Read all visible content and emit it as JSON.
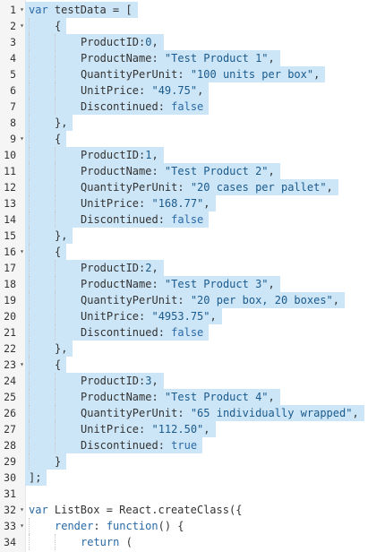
{
  "editor": {
    "lines": [
      {
        "n": "1",
        "fold": true,
        "indent": 0,
        "hl": true,
        "tokens": [
          [
            "kw",
            "var"
          ],
          [
            "pun",
            " testData = ["
          ]
        ]
      },
      {
        "n": "2",
        "fold": true,
        "indent": 1,
        "hl": true,
        "tokens": [
          [
            "pun",
            "{"
          ]
        ]
      },
      {
        "n": "3",
        "fold": false,
        "indent": 2,
        "hl": true,
        "tokens": [
          [
            "prop",
            "ProductID:"
          ],
          [
            "num-t",
            "0"
          ],
          [
            "pun",
            ","
          ]
        ]
      },
      {
        "n": "4",
        "fold": false,
        "indent": 2,
        "hl": true,
        "tokens": [
          [
            "prop",
            "ProductName: "
          ],
          [
            "str",
            "\"Test Product 1\""
          ],
          [
            "pun",
            ","
          ]
        ]
      },
      {
        "n": "5",
        "fold": false,
        "indent": 2,
        "hl": true,
        "tokens": [
          [
            "prop",
            "QuantityPerUnit: "
          ],
          [
            "str",
            "\"100 units per box\""
          ],
          [
            "pun",
            ","
          ]
        ]
      },
      {
        "n": "6",
        "fold": false,
        "indent": 2,
        "hl": true,
        "tokens": [
          [
            "prop",
            "UnitPrice: "
          ],
          [
            "str",
            "\"49.75\""
          ],
          [
            "pun",
            ","
          ]
        ]
      },
      {
        "n": "7",
        "fold": false,
        "indent": 2,
        "hl": true,
        "tokens": [
          [
            "prop",
            "Discontinued: "
          ],
          [
            "kw",
            "false"
          ]
        ]
      },
      {
        "n": "8",
        "fold": false,
        "indent": 1,
        "hl": true,
        "tokens": [
          [
            "pun",
            "},"
          ]
        ]
      },
      {
        "n": "9",
        "fold": true,
        "indent": 1,
        "hl": true,
        "tokens": [
          [
            "pun",
            "{"
          ]
        ]
      },
      {
        "n": "10",
        "fold": false,
        "indent": 2,
        "hl": true,
        "tokens": [
          [
            "prop",
            "ProductID:"
          ],
          [
            "num-t",
            "1"
          ],
          [
            "pun",
            ","
          ]
        ]
      },
      {
        "n": "11",
        "fold": false,
        "indent": 2,
        "hl": true,
        "tokens": [
          [
            "prop",
            "ProductName: "
          ],
          [
            "str",
            "\"Test Product 2\""
          ],
          [
            "pun",
            ","
          ]
        ]
      },
      {
        "n": "12",
        "fold": false,
        "indent": 2,
        "hl": true,
        "tokens": [
          [
            "prop",
            "QuantityPerUnit: "
          ],
          [
            "str",
            "\"20 cases per pallet\""
          ],
          [
            "pun",
            ","
          ]
        ]
      },
      {
        "n": "13",
        "fold": false,
        "indent": 2,
        "hl": true,
        "tokens": [
          [
            "prop",
            "UnitPrice: "
          ],
          [
            "str",
            "\"168.77\""
          ],
          [
            "pun",
            ","
          ]
        ]
      },
      {
        "n": "14",
        "fold": false,
        "indent": 2,
        "hl": true,
        "tokens": [
          [
            "prop",
            "Discontinued: "
          ],
          [
            "kw",
            "false"
          ]
        ]
      },
      {
        "n": "15",
        "fold": false,
        "indent": 1,
        "hl": true,
        "tokens": [
          [
            "pun",
            "},"
          ]
        ]
      },
      {
        "n": "16",
        "fold": true,
        "indent": 1,
        "hl": true,
        "tokens": [
          [
            "pun",
            "{"
          ]
        ]
      },
      {
        "n": "17",
        "fold": false,
        "indent": 2,
        "hl": true,
        "tokens": [
          [
            "prop",
            "ProductID:"
          ],
          [
            "num-t",
            "2"
          ],
          [
            "pun",
            ","
          ]
        ]
      },
      {
        "n": "18",
        "fold": false,
        "indent": 2,
        "hl": true,
        "tokens": [
          [
            "prop",
            "ProductName: "
          ],
          [
            "str",
            "\"Test Product 3\""
          ],
          [
            "pun",
            ","
          ]
        ]
      },
      {
        "n": "19",
        "fold": false,
        "indent": 2,
        "hl": true,
        "tokens": [
          [
            "prop",
            "QuantityPerUnit: "
          ],
          [
            "str",
            "\"20 per box, 20 boxes\""
          ],
          [
            "pun",
            ","
          ]
        ]
      },
      {
        "n": "20",
        "fold": false,
        "indent": 2,
        "hl": true,
        "tokens": [
          [
            "prop",
            "UnitPrice: "
          ],
          [
            "str",
            "\"4953.75\""
          ],
          [
            "pun",
            ","
          ]
        ]
      },
      {
        "n": "21",
        "fold": false,
        "indent": 2,
        "hl": true,
        "tokens": [
          [
            "prop",
            "Discontinued: "
          ],
          [
            "kw",
            "false"
          ]
        ]
      },
      {
        "n": "22",
        "fold": false,
        "indent": 1,
        "hl": true,
        "tokens": [
          [
            "pun",
            "},"
          ]
        ]
      },
      {
        "n": "23",
        "fold": true,
        "indent": 1,
        "hl": true,
        "tokens": [
          [
            "pun",
            "{"
          ]
        ]
      },
      {
        "n": "24",
        "fold": false,
        "indent": 2,
        "hl": true,
        "tokens": [
          [
            "prop",
            "ProductID:"
          ],
          [
            "num-t",
            "3"
          ],
          [
            "pun",
            ","
          ]
        ]
      },
      {
        "n": "25",
        "fold": false,
        "indent": 2,
        "hl": true,
        "tokens": [
          [
            "prop",
            "ProductName: "
          ],
          [
            "str",
            "\"Test Product 4\""
          ],
          [
            "pun",
            ","
          ]
        ]
      },
      {
        "n": "26",
        "fold": false,
        "indent": 2,
        "hl": true,
        "tokens": [
          [
            "prop",
            "QuantityPerUnit: "
          ],
          [
            "str",
            "\"65 individually wrapped\""
          ],
          [
            "pun",
            ","
          ]
        ]
      },
      {
        "n": "27",
        "fold": false,
        "indent": 2,
        "hl": true,
        "tokens": [
          [
            "prop",
            "UnitPrice: "
          ],
          [
            "str",
            "\"112.50\""
          ],
          [
            "pun",
            ","
          ]
        ]
      },
      {
        "n": "28",
        "fold": false,
        "indent": 2,
        "hl": true,
        "tokens": [
          [
            "prop",
            "Discontinued: "
          ],
          [
            "kw",
            "true"
          ]
        ]
      },
      {
        "n": "29",
        "fold": false,
        "indent": 1,
        "hl": true,
        "tokens": [
          [
            "pun",
            "}"
          ]
        ]
      },
      {
        "n": "30",
        "fold": false,
        "indent": 0,
        "hl": true,
        "tokens": [
          [
            "pun",
            "];"
          ]
        ]
      },
      {
        "n": "31",
        "fold": false,
        "indent": 0,
        "hl": false,
        "tokens": []
      },
      {
        "n": "32",
        "fold": true,
        "indent": 0,
        "hl": false,
        "tokens": [
          [
            "kw",
            "var"
          ],
          [
            "pun",
            " ListBox = React.createClass({"
          ]
        ]
      },
      {
        "n": "33",
        "fold": true,
        "indent": 1,
        "hl": false,
        "tokens": [
          [
            "fn",
            "render"
          ],
          [
            "pun",
            ": "
          ],
          [
            "kw",
            "function"
          ],
          [
            "pun",
            "() {"
          ]
        ]
      },
      {
        "n": "34",
        "fold": false,
        "indent": 2,
        "hl": false,
        "tokens": [
          [
            "kw",
            "return"
          ],
          [
            "pun",
            " ("
          ]
        ]
      }
    ],
    "fold_glyph": "▾"
  }
}
